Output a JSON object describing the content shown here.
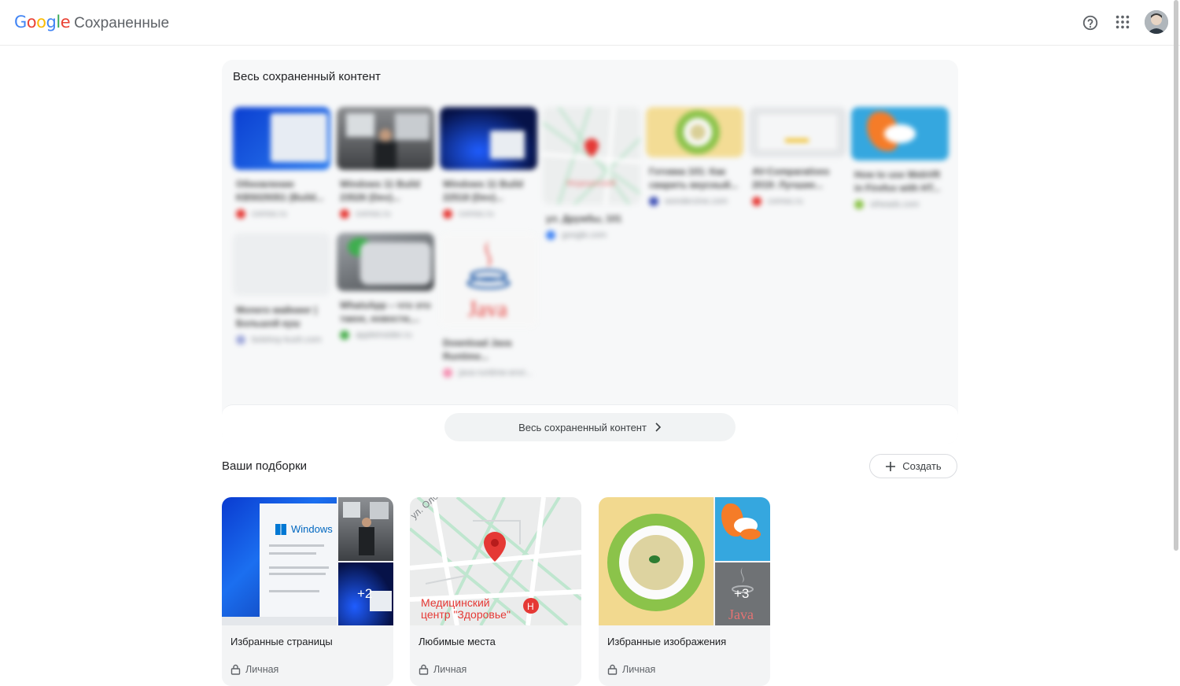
{
  "header": {
    "logo_letters": [
      "G",
      "o",
      "o",
      "g",
      "l",
      "e"
    ],
    "logo_colors": [
      "#4285F4",
      "#EA4335",
      "#FBBC05",
      "#4285F4",
      "#34A853",
      "#EA4335"
    ],
    "product": "Сохраненные",
    "icons": [
      "help-icon",
      "apps-grid-icon",
      "account-avatar"
    ]
  },
  "saved": {
    "title": "Весь сохраненный контент",
    "items": [
      {
        "title": "Обновление\nKB5029351 (Build...",
        "source": "comss.ru",
        "favicon": "#e53935"
      },
      {
        "title": "Windows 11 Build\n23526 (Dev)...",
        "source": "comss.ru",
        "favicon": "#e53935"
      },
      {
        "title": "Windows 11 Build\n22518 (Dev)...",
        "source": "comss.ru",
        "favicon": "#e53935"
      },
      {
        "title": "ул. Дружбы, 101",
        "source": "google.com",
        "favicon": "#4285F4"
      },
      {
        "title": "Готовка 101: Как\nсварить вкусный...",
        "source": "wonderzine.com",
        "favicon": "#3f51b5"
      },
      {
        "title": "AV-Comparatives\n2019: Лучшие...",
        "source": "comss.ru",
        "favicon": "#e53935"
      },
      {
        "title": "How to use WebVR\nin Firefox with HT...",
        "source": "oiheads.com",
        "favicon": "#8bc34a"
      },
      {
        "title": "Monero майнинг |\nБольшой куш",
        "source": "bolshoy-kush.com",
        "favicon": "#9fa8da"
      },
      {
        "title": "WhatsApp – что это\nтакое, новости,...",
        "source": "appleinsider.ru",
        "favicon": "#4caf50"
      },
      {
        "title": "Download Java\nRuntime...",
        "source": "java-runtime-envi...",
        "favicon": "#f48fb1"
      }
    ],
    "view_all_label": "Весь сохраненный контент"
  },
  "collections": {
    "title": "Ваши подборки",
    "create_label": "Создать",
    "items": [
      {
        "name": "Избранные страницы",
        "privacy": "Личная",
        "more": "+2"
      },
      {
        "name": "Любимые места",
        "privacy": "Личная",
        "map_street": "ул. Оломоу",
        "map_poi": "Медицинский\nцентр \"Здоровье\""
      },
      {
        "name": "Избранные изображения",
        "privacy": "Личная",
        "more": "+3"
      }
    ],
    "windows_label": "Windows",
    "java_label": "Java"
  }
}
